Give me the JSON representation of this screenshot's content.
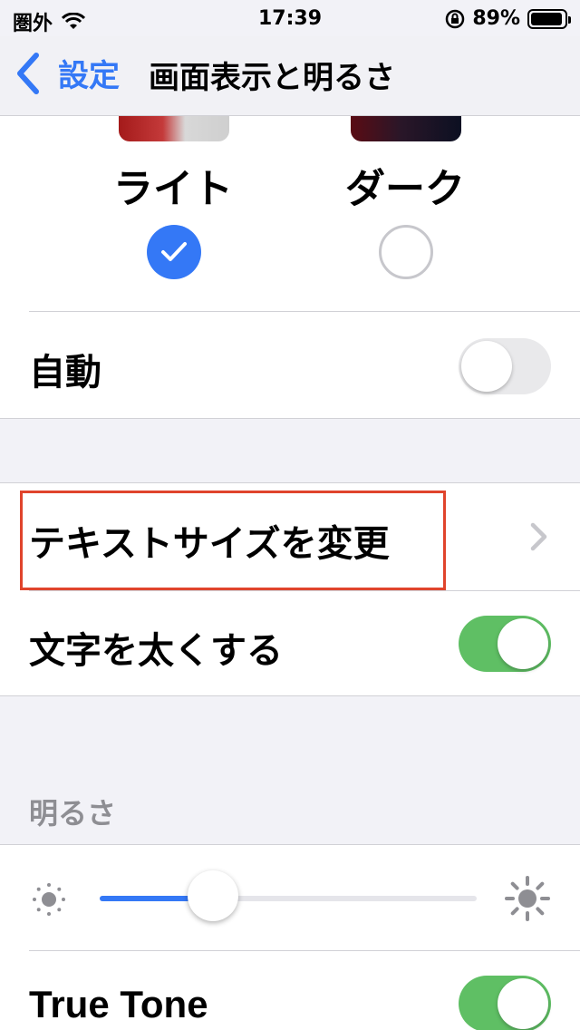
{
  "status_bar": {
    "carrier": "圏外",
    "time": "17:39",
    "battery_percent": "89%",
    "battery_level": 0.89,
    "icons": [
      "wifi-icon",
      "rotation-lock-icon",
      "battery-icon"
    ]
  },
  "nav": {
    "back_label": "設定",
    "title": "画面表示と明るさ"
  },
  "appearance": {
    "light_label": "ライト",
    "dark_label": "ダーク",
    "selected": "light"
  },
  "rows": {
    "auto_label": "自動",
    "auto_on": false,
    "text_size_label": "テキストサイズを変更",
    "bold_text_label": "文字を太くする",
    "bold_text_on": true
  },
  "brightness": {
    "section_header": "明るさ",
    "level": 0.3,
    "true_tone_label": "True Tone",
    "true_tone_on": true
  },
  "colors": {
    "accent": "#3478f6",
    "toggle_on": "#5fbf64",
    "highlight": "#e0442c"
  }
}
